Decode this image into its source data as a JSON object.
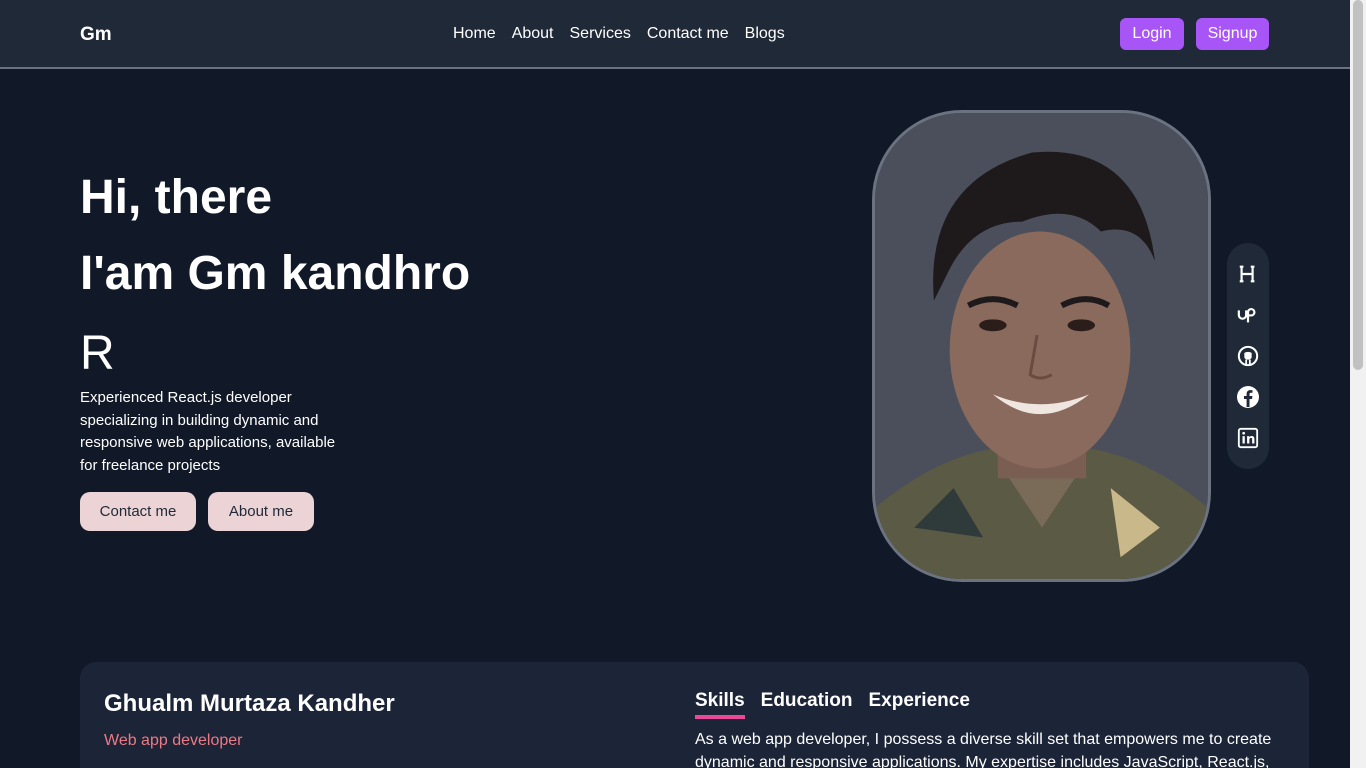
{
  "nav": {
    "brand": "Gm",
    "links": [
      "Home",
      "About",
      "Services",
      "Contact me",
      "Blogs"
    ],
    "login": "Login",
    "signup": "Signup"
  },
  "hero": {
    "greeting": "Hi, there",
    "intro": "I'am Gm kandhro",
    "typing": "R",
    "description": "Experienced React.js developer specializing in building dynamic and responsive web applications, available for freelance projects",
    "contact_button": "Contact me",
    "about_button": "About me"
  },
  "social": [
    "hashnode-icon",
    "upwork-icon",
    "github-icon",
    "facebook-icon",
    "linkedin-icon"
  ],
  "profile": {
    "name": "Ghualm Murtaza Kandher",
    "role": "Web app developer",
    "tabs": [
      "Skills",
      "Education",
      "Experience"
    ],
    "active_tab": "Skills",
    "content": "As a web app developer, I possess a diverse skill set that empowers me to create dynamic and responsive applications. My expertise includes JavaScript, React.js, and"
  },
  "colors": {
    "background": "#111827",
    "navbar": "#1f2937",
    "accent": "#a855f7",
    "button": "#ecd4d6",
    "role": "#ec7a85",
    "tab_underline": "#ec4899"
  }
}
